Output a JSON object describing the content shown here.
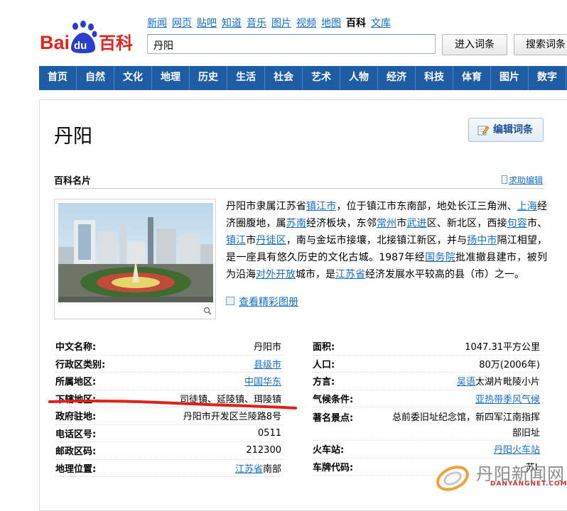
{
  "topnav": [
    "新闻",
    "网页",
    "贴吧",
    "知道",
    "音乐",
    "图片",
    "视频",
    "地图",
    "百科",
    "文库"
  ],
  "topnav_active_index": 8,
  "logo": {
    "text_bai": "Bai",
    "text_du": "du",
    "text_baike": "百科"
  },
  "search": {
    "value": "丹阳"
  },
  "buttons": {
    "enter": "进入词条",
    "search": "搜索词条",
    "edit": "编辑词条"
  },
  "mainnav": [
    "首页",
    "自然",
    "文化",
    "地理",
    "历史",
    "生活",
    "社会",
    "艺术",
    "人物",
    "经济",
    "科技",
    "体育",
    "图片",
    "数字"
  ],
  "page": {
    "title": "丹阳"
  },
  "section": {
    "title": "百科名片",
    "help": "求助编辑"
  },
  "intro": [
    {
      "t": "丹阳市隶属江苏省"
    },
    {
      "t": "镇江市",
      "link": true
    },
    {
      "t": "，位于镇江市东南部，地处长江三角洲、"
    },
    {
      "t": "上海",
      "link": true
    },
    {
      "t": "经济圈腹地，属"
    },
    {
      "t": "苏南",
      "link": true
    },
    {
      "t": "经济板块，东邻"
    },
    {
      "t": "常州",
      "link": true
    },
    {
      "t": "市"
    },
    {
      "t": "武进",
      "link": true
    },
    {
      "t": "区、新北区，西接"
    },
    {
      "t": "句容",
      "link": true
    },
    {
      "t": "市、"
    },
    {
      "t": "镇江",
      "link": true
    },
    {
      "t": "市"
    },
    {
      "t": "丹徒区",
      "link": true
    },
    {
      "t": "，南与金坛市接壤，北接镇江新区，并与"
    },
    {
      "t": "扬中市",
      "link": true
    },
    {
      "t": "隔江相望，是一座具有悠久历史的文化古城。1987年经"
    },
    {
      "t": "国务院",
      "link": true
    },
    {
      "t": "批准撤县建市，被列为沿海"
    },
    {
      "t": "对外开放",
      "link": true
    },
    {
      "t": "城市，是"
    },
    {
      "t": "江苏省",
      "link": true
    },
    {
      "t": "经济发展水平较高的县（市）之一。"
    }
  ],
  "gallery_link": "查看精彩图册",
  "info_left": [
    {
      "label": "中文名称:",
      "value": "丹阳市"
    },
    {
      "label": "行政区类别:",
      "value": "县级市",
      "link": true
    },
    {
      "label": "所属地区:",
      "value": "中国华东",
      "link": true
    },
    {
      "label": "下辖地区:",
      "value": "司徒镇、延陵镇、珥陵镇"
    },
    {
      "label": "政府驻地:",
      "value": "丹阳市开发区兰陵路8号"
    },
    {
      "label": "电话区号:",
      "value": "0511"
    },
    {
      "label": "邮政区码:",
      "value": "212300"
    },
    {
      "label": "地理位置:",
      "value_link": "江苏省",
      "value_rest": "南部"
    }
  ],
  "info_right": [
    {
      "label": "面积:",
      "value": "1047.31平方公里"
    },
    {
      "label": "人口:",
      "value": "80万(2006年)"
    },
    {
      "label": "方言:",
      "value_link": "吴语",
      "value_rest": "太湖片毗陵小片"
    },
    {
      "label": "气候条件:",
      "value": "亚热带季风气候",
      "link": true
    },
    {
      "label": "著名景点:",
      "value": "总前委旧址纪念馆，新四军江南指挥部旧址",
      "tall": true
    },
    {
      "label": "火车站:",
      "value": "丹阳火车站",
      "link": true
    },
    {
      "label": "车牌代码:",
      "value": "苏L"
    }
  ],
  "watermark": {
    "text": "丹阳新闻网",
    "sub": "DANYANGNET.COM"
  },
  "colors": {
    "nav_bg": "#1e5da4",
    "link": "#136ec2",
    "annotation": "#e0201b"
  }
}
